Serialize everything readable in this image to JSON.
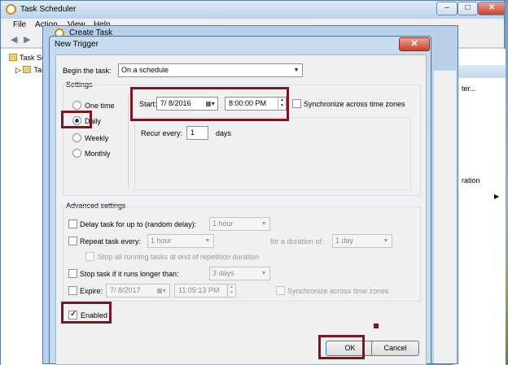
{
  "task_scheduler": {
    "title": "Task Scheduler",
    "menu": [
      "File",
      "Action",
      "View",
      "Help"
    ],
    "tree": [
      "Task Sch",
      "Task"
    ],
    "right_panel": [
      "ter...",
      "ration"
    ]
  },
  "create_task": {
    "title": "Create Task"
  },
  "new_trigger": {
    "title": "New Trigger",
    "begin_label": "Begin the task:",
    "begin_value": "On a schedule",
    "settings_label": "Settings",
    "schedule_options": [
      "One time",
      "Daily",
      "Weekly",
      "Monthly"
    ],
    "selected_option": "Daily",
    "start_label": "Start:",
    "start_date": "7/ 8/2016",
    "start_time": "8:00:00 PM",
    "sync_label": "Synchronize across time zones",
    "recur_label": "Recur every:",
    "recur_value": "1",
    "recur_unit": "days",
    "advanced_label": "Advanced settings",
    "delay_label": "Delay task for up to (random delay):",
    "delay_value": "1 hour",
    "repeat_label": "Repeat task every:",
    "repeat_value": "1 hour",
    "duration_label": "for a duration of:",
    "duration_value": "1 day",
    "stop_running_label": "Stop all running tasks at end of repetition duration",
    "stop_longer_label": "Stop task if it runs longer than:",
    "stop_longer_value": "3 days",
    "expire_label": "Expire:",
    "expire_date": "7/ 8/2017",
    "expire_time": "11:05:13 PM",
    "expire_sync_label": "Synchronize across time zones",
    "enabled_label": "Enabled",
    "ok_label": "OK",
    "cancel_label": "Cancel"
  },
  "colors": {
    "highlight": "#7a1523",
    "dialog_frame": "#c7dbee"
  },
  "icons": {
    "close": "close-icon",
    "calendar": "calendar-dropdown-icon",
    "spin": "spin-arrows-icon",
    "check": "check-icon"
  }
}
